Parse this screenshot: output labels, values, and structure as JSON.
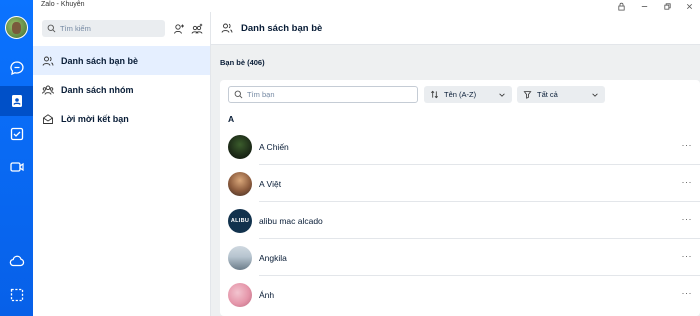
{
  "app": {
    "title": "Zalo - Khuyên"
  },
  "rail": {
    "items": [
      {
        "name": "messages",
        "icon": "chat-icon"
      },
      {
        "name": "contacts",
        "icon": "contacts-icon",
        "active": true
      },
      {
        "name": "todo",
        "icon": "checkbox-icon"
      },
      {
        "name": "video",
        "icon": "video-icon"
      },
      {
        "name": "cloud",
        "icon": "cloud-icon"
      },
      {
        "name": "screenshot",
        "icon": "screenshot-icon"
      }
    ]
  },
  "middle": {
    "search_placeholder": "Tìm kiếm",
    "menu": [
      {
        "label": "Danh sách bạn bè",
        "icon": "friends-icon",
        "active": true
      },
      {
        "label": "Danh sách nhóm",
        "icon": "group-icon"
      },
      {
        "label": "Lời mời kết bạn",
        "icon": "envelope-icon"
      }
    ]
  },
  "main": {
    "header_title": "Danh sách bạn bè",
    "count_label": "Bạn bè (406)",
    "search_placeholder": "Tìm bạn",
    "sort_label": "Tên (A-Z)",
    "filter_label": "Tất cả",
    "section_letter": "A",
    "friends": [
      {
        "name": "A Chiến"
      },
      {
        "name": "A Việt"
      },
      {
        "name": "alibu mac alcado",
        "avatar_text": "ALIBU"
      },
      {
        "name": "Angkila"
      },
      {
        "name": "Ánh"
      }
    ],
    "more_label": "···"
  },
  "colors": {
    "accent": "#0068ff",
    "active_bg": "#e5efff"
  }
}
